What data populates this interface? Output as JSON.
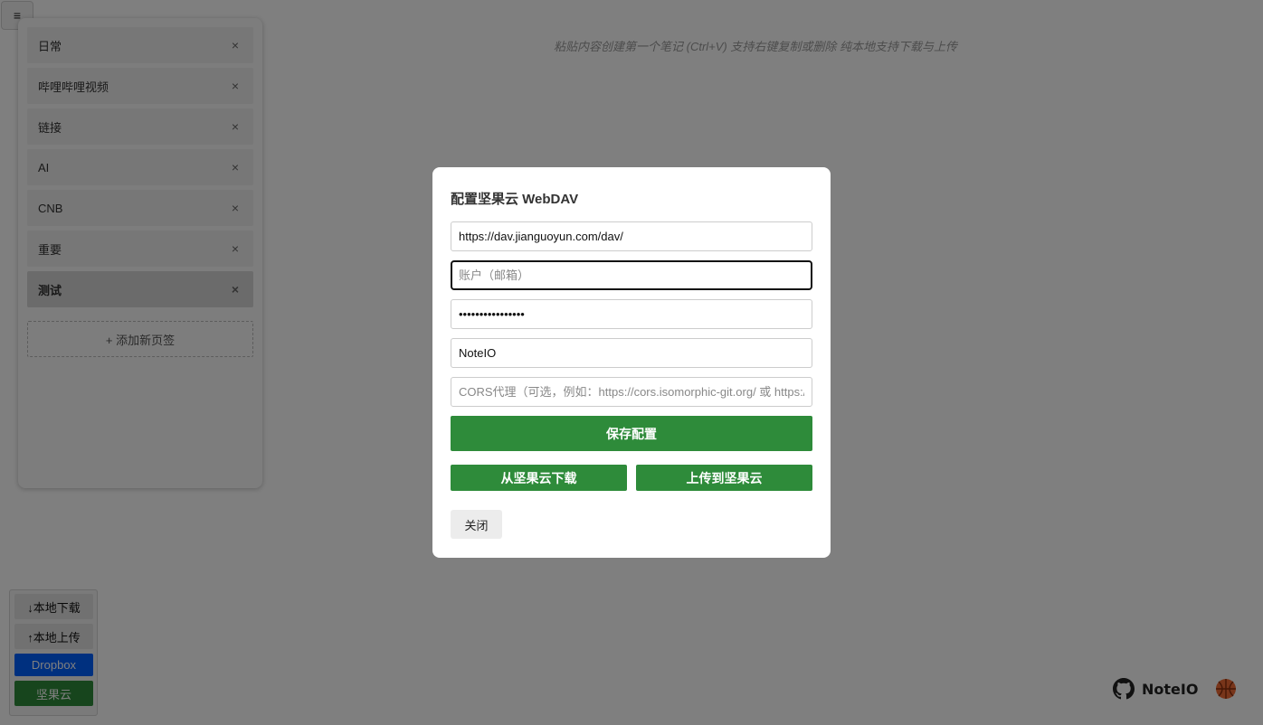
{
  "menu_toggle": {
    "icon": "hamburger-icon",
    "glyph": "≡"
  },
  "sidebar": {
    "tabs": [
      {
        "label": "日常",
        "close": "×"
      },
      {
        "label": "哔哩哔哩视频",
        "close": "×"
      },
      {
        "label": "链接",
        "close": "×"
      },
      {
        "label": "AI",
        "close": "×"
      },
      {
        "label": "CNB",
        "close": "×"
      },
      {
        "label": "重要",
        "close": "×"
      },
      {
        "label": "测试",
        "close": "×",
        "active": true
      }
    ],
    "add_tab_label": "+ 添加新页签"
  },
  "editor": {
    "hint": "粘贴内容创建第一个笔记 (Ctrl+V) 支持右键复制或删除 纯本地支持下载与上传"
  },
  "bottom_panel": {
    "local_download": "↓本地下载",
    "local_upload": "↑本地上传",
    "dropbox": "Dropbox",
    "jianguoyun": "坚果云"
  },
  "brand": {
    "name": "NoteIO",
    "github_icon": "github-icon",
    "ball_icon": "basketball-icon"
  },
  "modal": {
    "title": "配置坚果云 WebDAV",
    "url_value": "https://dav.jianguoyun.com/dav/",
    "account_placeholder": "账户（邮箱）",
    "password_value": "••••••••••••••••",
    "folder_value": "NoteIO",
    "cors_placeholder": "CORS代理（可选，例如：https://cors.isomorphic-git.org/ 或 https://",
    "save_label": "保存配置",
    "download_label": "从坚果云下载",
    "upload_label": "上传到坚果云",
    "close_label": "关闭"
  },
  "colors": {
    "accent_green": "#2e8b3a",
    "dropbox_blue": "#0061fe",
    "brand_orange": "#f06a35"
  }
}
